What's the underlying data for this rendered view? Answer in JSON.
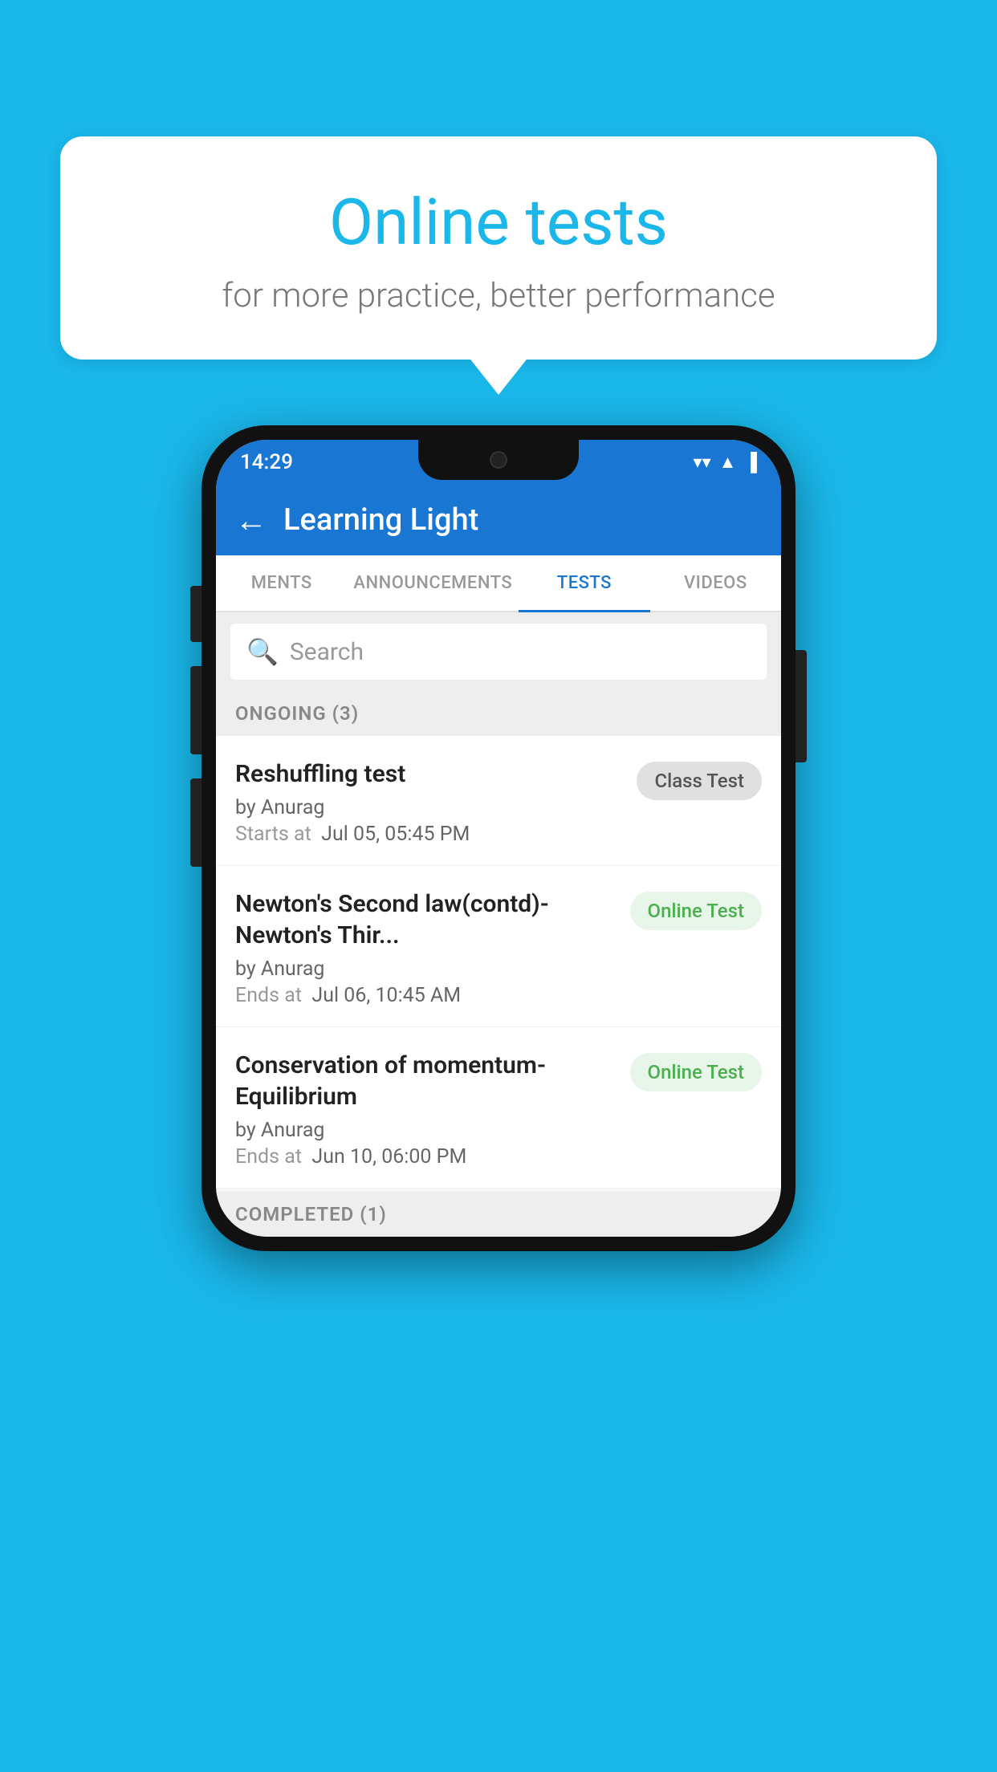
{
  "promo": {
    "title": "Online tests",
    "subtitle": "for more practice, better performance"
  },
  "phone": {
    "statusBar": {
      "time": "14:29",
      "wifiIcon": "wifi",
      "signalIcon": "signal",
      "batteryIcon": "battery"
    },
    "header": {
      "backLabel": "←",
      "title": "Learning Light"
    },
    "tabs": [
      {
        "label": "MENTS",
        "active": false
      },
      {
        "label": "ANNOUNCEMENTS",
        "active": false
      },
      {
        "label": "TESTS",
        "active": true
      },
      {
        "label": "VIDEOS",
        "active": false
      }
    ],
    "search": {
      "placeholder": "Search"
    },
    "ongoingSection": {
      "label": "ONGOING (3)"
    },
    "tests": [
      {
        "name": "Reshuffling test",
        "author": "by Anurag",
        "timeLabel": "Starts at",
        "time": "Jul 05, 05:45 PM",
        "badgeText": "Class Test",
        "badgeType": "gray"
      },
      {
        "name": "Newton's Second law(contd)-Newton's Thir...",
        "author": "by Anurag",
        "timeLabel": "Ends at",
        "time": "Jul 06, 10:45 AM",
        "badgeText": "Online Test",
        "badgeType": "green"
      },
      {
        "name": "Conservation of momentum-Equilibrium",
        "author": "by Anurag",
        "timeLabel": "Ends at",
        "time": "Jun 10, 06:00 PM",
        "badgeText": "Online Test",
        "badgeType": "green"
      }
    ],
    "completedSection": {
      "label": "COMPLETED (1)"
    }
  }
}
